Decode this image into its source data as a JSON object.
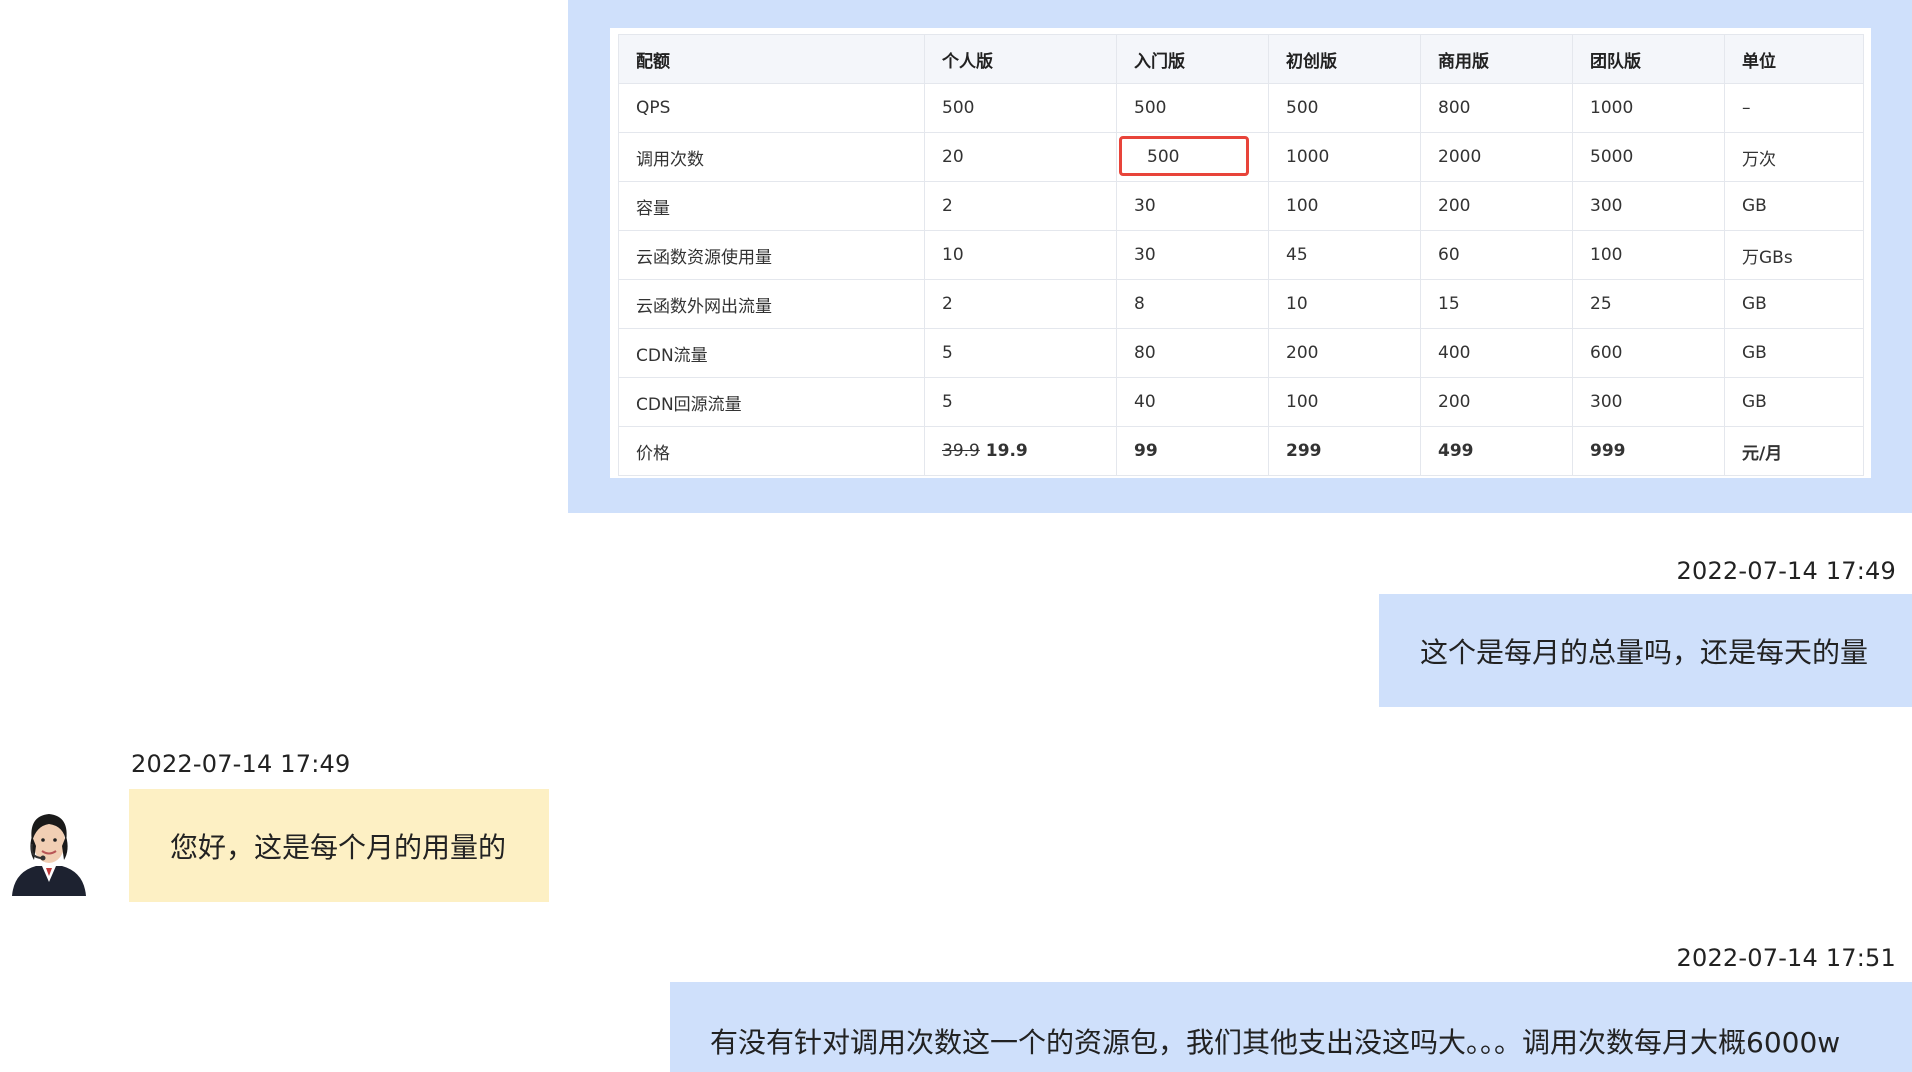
{
  "table": {
    "headers": [
      "配额",
      "个人版",
      "入门版",
      "初创版",
      "商用版",
      "团队版",
      "单位"
    ],
    "rows": [
      [
        "QPS",
        "500",
        "500",
        "500",
        "800",
        "1000",
        "–"
      ],
      [
        "调用次数",
        "20",
        "500",
        "1000",
        "2000",
        "5000",
        "万次"
      ],
      [
        "容量",
        "2",
        "30",
        "100",
        "200",
        "300",
        "GB"
      ],
      [
        "云函数资源使用量",
        "10",
        "30",
        "45",
        "60",
        "100",
        "万GBs"
      ],
      [
        "云函数外网出流量",
        "2",
        "8",
        "10",
        "15",
        "25",
        "GB"
      ],
      [
        "CDN流量",
        "5",
        "80",
        "200",
        "400",
        "600",
        "GB"
      ],
      [
        "CDN回源流量",
        "5",
        "40",
        "100",
        "200",
        "300",
        "GB"
      ]
    ],
    "price": {
      "label": "价格",
      "personal_old": "39.9",
      "personal_new": "19.9",
      "starter": "99",
      "startup": "299",
      "business": "499",
      "team": "999",
      "unit": "元/月"
    },
    "highlight_color": "#e8443a"
  },
  "messages": [
    {
      "timestamp": "2022-07-14 17:49",
      "text": "这个是每月的总量吗，还是每天的量"
    },
    {
      "timestamp": "2022-07-14 17:49",
      "text": "您好，这是每个月的用量的"
    },
    {
      "timestamp": "2022-07-14 17:51",
      "text": "有没有针对调用次数这一个的资源包，我们其他支出没这吗大。。。调用次数每月大概6000w"
    }
  ],
  "colors": {
    "outgoing_bubble": "#cfe0fb",
    "incoming_bubble": "#fdf0c4"
  },
  "icons": {
    "agent_avatar": "customer-service-agent-avatar"
  }
}
